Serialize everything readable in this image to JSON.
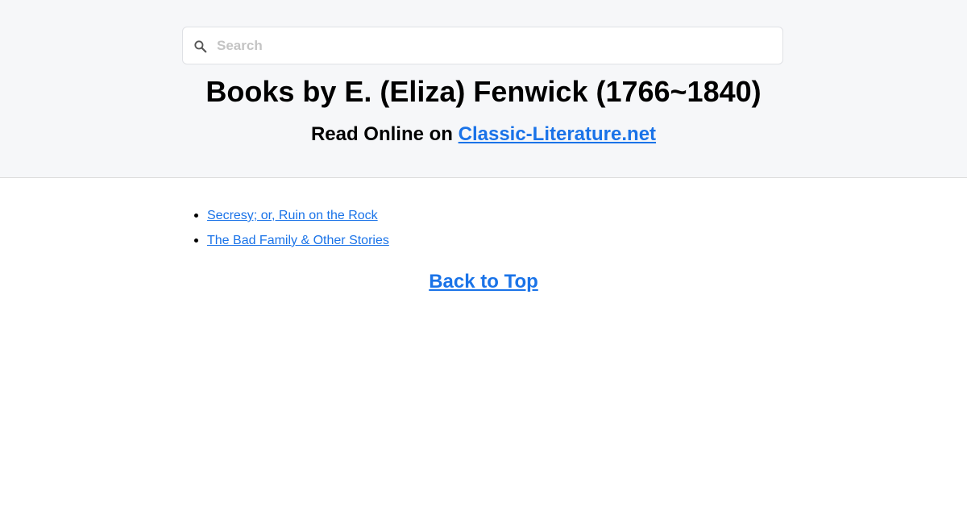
{
  "search": {
    "placeholder": "Search",
    "value": ""
  },
  "header": {
    "title": "Books by E. (Eliza) Fenwick (1766~1840)",
    "subtitle_prefix": "Read Online on ",
    "site_link_label": "Classic-Literature.net"
  },
  "books": [
    {
      "label": "Secresy; or, Ruin on the Rock"
    },
    {
      "label": "The Bad Family & Other Stories"
    }
  ],
  "footer": {
    "back_to_top_label": "Back to Top"
  },
  "colors": {
    "link": "#1a73e8",
    "header_bg": "#f6f7f9"
  },
  "icons": {
    "search": "search-icon"
  }
}
